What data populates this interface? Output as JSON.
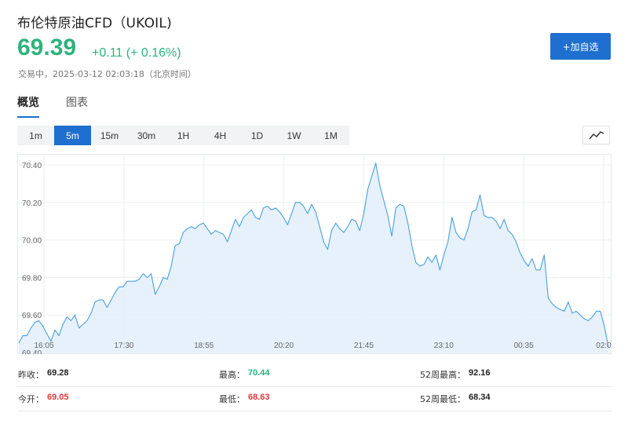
{
  "header": {
    "title": "布伦特原油CFD（UKOIL)",
    "price": "69.39",
    "change": "+0.11 (+ 0.16%)",
    "status": "交易中，2025-03-12 02:03:18（北京时间）",
    "add_button": "+加自选"
  },
  "tabs": [
    {
      "label": "概览",
      "active": true
    },
    {
      "label": "图表",
      "active": false
    }
  ],
  "periods": [
    {
      "label": "1m",
      "active": false
    },
    {
      "label": "5m",
      "active": true
    },
    {
      "label": "15m",
      "active": false
    },
    {
      "label": "30m",
      "active": false
    },
    {
      "label": "1H",
      "active": false
    },
    {
      "label": "4H",
      "active": false
    },
    {
      "label": "1D",
      "active": false
    },
    {
      "label": "1W",
      "active": false
    },
    {
      "label": "1M",
      "active": false
    }
  ],
  "chart_type_icon": "line-chart-icon",
  "colors": {
    "up": "#2db37d",
    "down": "#e2393b",
    "accent": "#1e6fcf",
    "line": "#4a9fe0",
    "fill": "#e3f0fb"
  },
  "chart_data": {
    "type": "area",
    "title": "",
    "xlabel": "",
    "ylabel": "",
    "ylim": [
      69.4,
      70.45
    ],
    "yticks": [
      70.4,
      70.2,
      70.0,
      69.8,
      69.6,
      69.4
    ],
    "ytick_labels": [
      "70.40",
      "70.20",
      "70.00",
      "69.80",
      "69.60",
      "69.40"
    ],
    "xticks": [
      "16:05",
      "17:30",
      "18:55",
      "20:20",
      "21:45",
      "23:10",
      "00:35",
      "02:0"
    ],
    "grid": true,
    "series": [
      {
        "values": [
          69.45,
          69.49,
          69.49,
          69.53,
          69.56,
          69.57,
          69.54,
          69.5,
          69.46,
          69.52,
          69.49,
          69.55,
          69.59,
          69.57,
          69.6,
          69.53,
          69.55,
          69.57,
          69.61,
          69.67,
          69.68,
          69.68,
          69.64,
          69.68,
          69.72,
          69.75,
          69.75,
          69.78,
          69.78,
          69.78,
          69.79,
          69.82,
          69.8,
          69.82,
          69.71,
          69.75,
          69.8,
          69.79,
          69.86,
          69.97,
          69.98,
          70.04,
          70.06,
          70.07,
          70.06,
          70.08,
          70.09,
          70.06,
          70.03,
          70.05,
          70.04,
          70.03,
          69.99,
          70.05,
          70.11,
          70.07,
          70.12,
          70.14,
          70.16,
          70.12,
          70.11,
          70.17,
          70.18,
          70.16,
          70.17,
          70.15,
          70.12,
          70.08,
          70.14,
          70.2,
          70.2,
          70.18,
          70.14,
          70.19,
          70.15,
          70.07,
          69.99,
          69.95,
          70.05,
          70.09,
          70.06,
          70.04,
          70.07,
          70.11,
          70.1,
          70.05,
          70.14,
          70.27,
          70.34,
          70.41,
          70.29,
          70.21,
          70.13,
          70.02,
          70.17,
          70.19,
          70.18,
          70.09,
          69.97,
          69.88,
          69.86,
          69.87,
          69.91,
          69.88,
          69.92,
          69.84,
          69.92,
          69.99,
          70.12,
          70.04,
          70.01,
          70.0,
          70.06,
          70.15,
          70.16,
          70.24,
          70.13,
          70.12,
          70.12,
          70.1,
          70.06,
          70.11,
          70.05,
          70.03,
          69.99,
          69.93,
          69.89,
          69.86,
          69.9,
          69.84,
          69.84,
          69.92,
          69.69,
          69.66,
          69.64,
          69.63,
          69.62,
          69.67,
          69.61,
          69.62,
          69.6,
          69.58,
          69.57,
          69.59,
          69.62,
          69.62,
          69.54,
          69.43
        ]
      }
    ]
  },
  "stats": [
    [
      {
        "label": "昨收：",
        "value": "69.28",
        "tone": "neutral"
      },
      {
        "label": "最高：",
        "value": "70.44",
        "tone": "up"
      },
      {
        "label": "52周最高：",
        "value": "92.16",
        "tone": "neutral"
      }
    ],
    [
      {
        "label": "今开：",
        "value": "69.05",
        "tone": "down"
      },
      {
        "label": "最低：",
        "value": "68.63",
        "tone": "down"
      },
      {
        "label": "52周最低：",
        "value": "68.34",
        "tone": "neutral"
      }
    ]
  ]
}
